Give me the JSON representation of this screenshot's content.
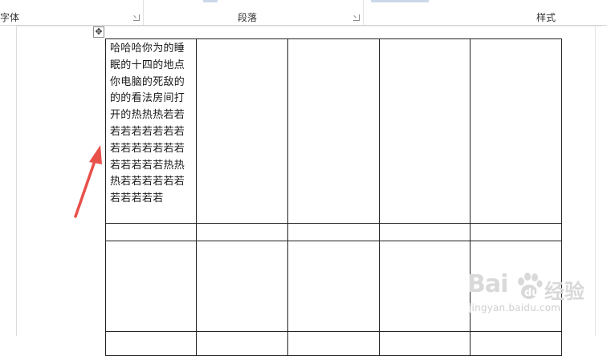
{
  "ribbon": {
    "font_group_label": "字体",
    "paragraph_group_label": "段落",
    "styles_group_label": "样式"
  },
  "table": {
    "first_cell_text": "哈哈哈你为的睡眠的十四的地点你电脑的死敌的的的看法房间打开的热热热若若若若若若若若若若若若若若若若若若若若若热热热若若若若若若若若若若若"
  },
  "watermark": {
    "logo_text": "Bai",
    "logo_suffix": "经验",
    "url": "jingyan.baidu.com"
  },
  "colors": {
    "arrow": "#e8504a",
    "table_border": "#222222",
    "watermark": "#d9d9d9"
  }
}
